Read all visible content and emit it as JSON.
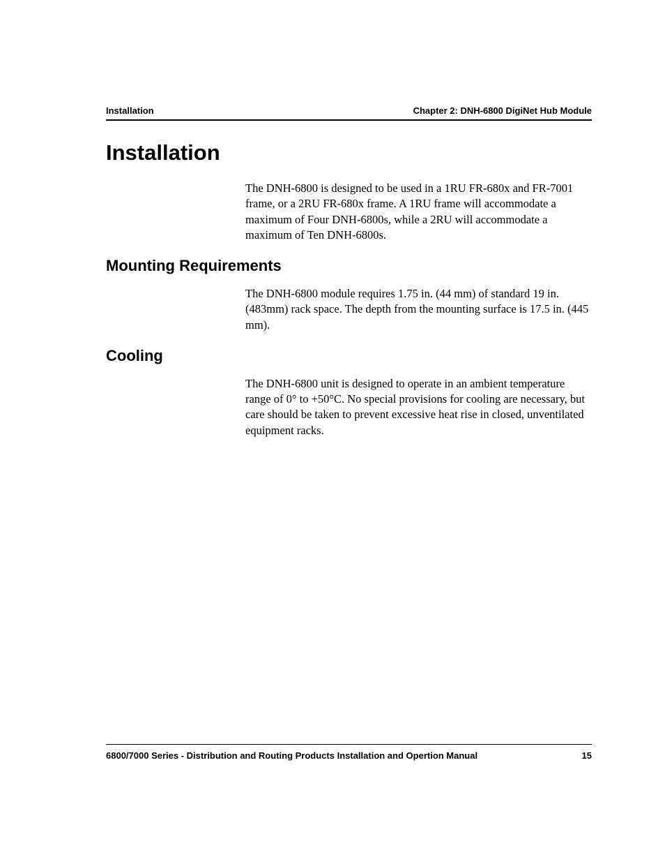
{
  "header": {
    "left": "Installation",
    "right": "Chapter 2: DNH-6800 DigiNet Hub Module"
  },
  "sections": {
    "main_title": "Installation",
    "intro_paragraph": "The DNH-6800 is designed to be used in a 1RU FR-680x and FR-7001 frame, or a 2RU FR-680x frame. A 1RU frame will accommodate a maximum of Four DNH-6800s, while a 2RU will accommodate a maximum of Ten DNH-6800s.",
    "mounting": {
      "title": "Mounting Requirements",
      "paragraph": "The DNH-6800 module requires 1.75 in. (44 mm) of standard 19 in. (483mm) rack space. The depth from the mounting surface is 17.5 in. (445 mm)."
    },
    "cooling": {
      "title": "Cooling",
      "paragraph": "The DNH-6800 unit is designed to operate in an ambient temperature range of 0° to +50°C. No special provisions for cooling are necessary, but care should be taken to prevent excessive heat rise in closed, unventilated equipment racks."
    }
  },
  "footer": {
    "left": "6800/7000 Series - Distribution and Routing Products Installation and Opertion Manual",
    "page_number": "15"
  }
}
